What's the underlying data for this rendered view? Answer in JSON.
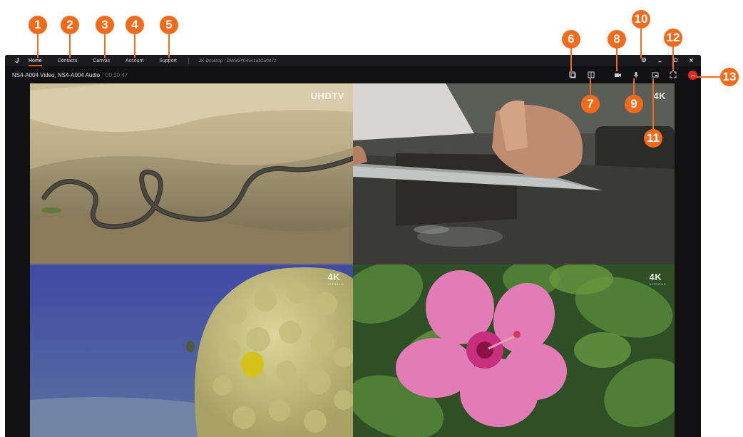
{
  "menu": {
    "logo_glyph": "J",
    "items": [
      {
        "label": "Home",
        "active": true
      },
      {
        "label": "Contacts",
        "active": false
      },
      {
        "label": "Canvas",
        "active": false
      },
      {
        "label": "Account",
        "active": false
      },
      {
        "label": "Support",
        "active": false
      }
    ],
    "window_title": "JK Desktop - DW6G4045v1ab250872"
  },
  "call": {
    "title": "NS4-A004 Video, NS4-A004 Audio",
    "timer": "00:30:47"
  },
  "callouts": [
    "1",
    "2",
    "3",
    "4",
    "5",
    "6",
    "7",
    "8",
    "9",
    "10",
    "11",
    "12",
    "13"
  ],
  "tiles": [
    {
      "name": "road-landscape",
      "badge": "UHDTV",
      "badge_sub": ""
    },
    {
      "name": "knife-sharpening",
      "badge": "4K",
      "badge_sub": ""
    },
    {
      "name": "coral-reef",
      "badge": "4K",
      "badge_sub": "ULTRA HD"
    },
    {
      "name": "hibiscus-flower",
      "badge": "4K",
      "badge_sub": "ULTRA HD"
    }
  ],
  "colors": {
    "callout": "#f26a1b",
    "end_call": "#e0281d",
    "active_tab_underline": "#e55a1a"
  }
}
